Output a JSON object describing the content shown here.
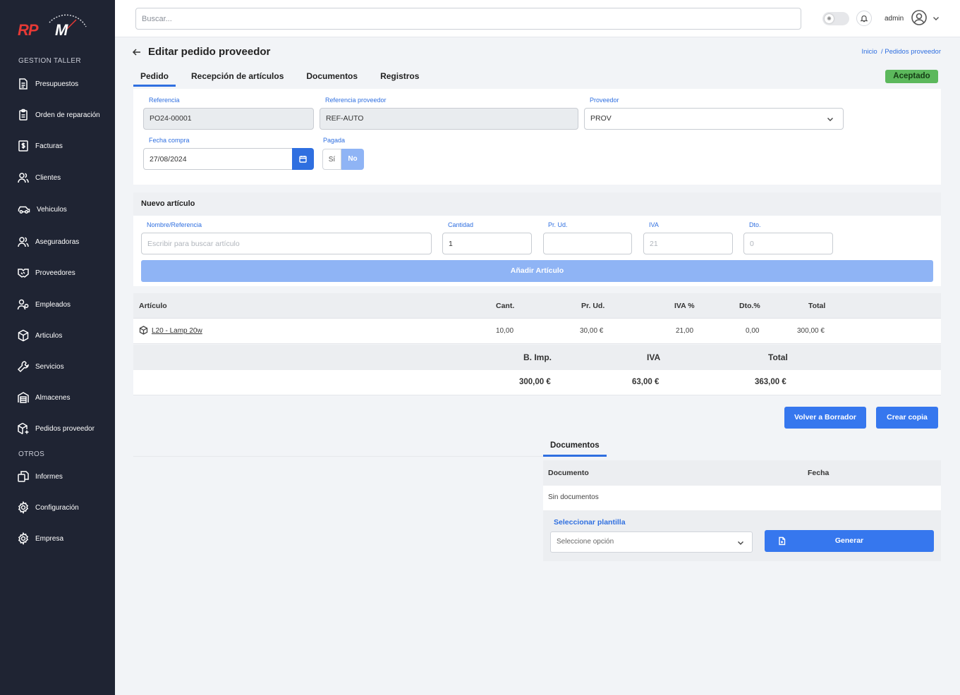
{
  "colors": {
    "sidebar_bg": "#1f2433",
    "accent": "#2f6fe0",
    "status": "#5cb85c",
    "logo_red": "#e53935"
  },
  "brand": {
    "logo_text": "RPM"
  },
  "sidebar": {
    "section_taller": "GESTION TALLER",
    "section_otros": "OTROS",
    "items": [
      {
        "label": "Presupuestos",
        "icon": "document-icon"
      },
      {
        "label": "Orden de reparación",
        "icon": "clipboard-icon"
      },
      {
        "label": "Facturas",
        "icon": "invoice-icon"
      },
      {
        "label": "Clientes",
        "icon": "users-icon"
      },
      {
        "label": "Vehiculos",
        "icon": "car-icon"
      },
      {
        "label": "Aseguradoras",
        "icon": "users-icon"
      },
      {
        "label": "Proveedores",
        "icon": "handshake-icon"
      },
      {
        "label": "Empleados",
        "icon": "employee-icon"
      },
      {
        "label": "Articulos",
        "icon": "box-icon"
      },
      {
        "label": "Servicios",
        "icon": "wrench-icon"
      },
      {
        "label": "Almacenes",
        "icon": "warehouse-icon"
      },
      {
        "label": "Pedidos proveedor",
        "icon": "package-icon"
      },
      {
        "label": "Informes",
        "icon": "copy-icon"
      },
      {
        "label": "Configuración",
        "icon": "gear-icon"
      },
      {
        "label": "Empresa",
        "icon": "gear-icon"
      }
    ]
  },
  "topbar": {
    "search_placeholder": "Buscar...",
    "user": "admin"
  },
  "page": {
    "title": "Editar pedido proveedor",
    "breadcrumb_home": "Inicio",
    "breadcrumb_current": "/ Pedidos proveedor",
    "tabs": [
      "Pedido",
      "Recepción de artículos",
      "Documentos",
      "Registros"
    ],
    "status": "Aceptado"
  },
  "form": {
    "referencia_label": "Referencia",
    "referencia_value": "PO24-00001",
    "ref_prov_label": "Referencia proveedor",
    "ref_prov_value": "REF-AUTO",
    "proveedor_label": "Proveedor",
    "proveedor_value": "PROV",
    "fecha_label": "Fecha compra",
    "fecha_value": "27/08/2024",
    "pagada_label": "Pagada",
    "pagada_si": "Sí",
    "pagada_no": "No"
  },
  "nuevo": {
    "title": "Nuevo artículo",
    "nombre_label": "Nombre/Referencia",
    "nombre_placeholder": "Escribir para buscar artículo",
    "cantidad_label": "Cantidad",
    "cantidad_value": "1",
    "prud_label": "Pr. Ud.",
    "iva_label": "IVA",
    "iva_placeholder": "21",
    "dto_label": "Dto.",
    "dto_placeholder": "0",
    "add_button": "Añadir Artículo"
  },
  "table": {
    "headers": [
      "Artículo",
      "Cant.",
      "Pr. Ud.",
      "IVA %",
      "Dto.%",
      "Total"
    ],
    "rows": [
      {
        "articulo": "L20 - Lamp 20w",
        "cant": "10,00",
        "prud": "30,00 €",
        "iva": "21,00",
        "dto": "0,00",
        "total": "300,00 €"
      }
    ]
  },
  "summary": {
    "headers": [
      "B. Imp.",
      "IVA",
      "Total"
    ],
    "values": [
      "300,00 €",
      "63,00 €",
      "363,00 €"
    ]
  },
  "actions": {
    "volver": "Volver a Borrador",
    "copia": "Crear copia"
  },
  "documents": {
    "tab": "Documentos",
    "col_doc": "Documento",
    "col_fecha": "Fecha",
    "empty": "Sin documentos",
    "template_label": "Seleccionar plantilla",
    "template_placeholder": "Seleccione opción",
    "generate": "Generar"
  }
}
